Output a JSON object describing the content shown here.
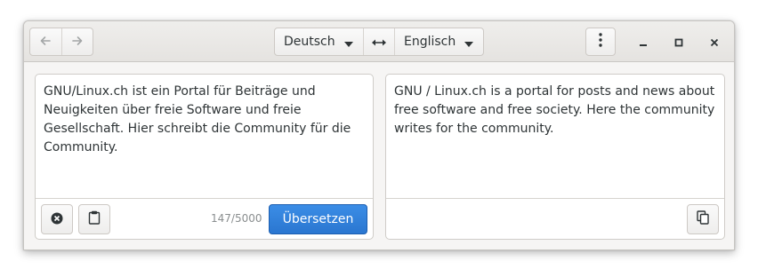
{
  "header": {
    "back_icon": "arrow-left-icon",
    "forward_icon": "arrow-right-icon",
    "source_language": "Deutsch",
    "target_language": "Englisch",
    "swap_icon": "swap-arrows-icon",
    "menu_icon": "vertical-dots-icon",
    "window_controls": [
      "minimize-icon",
      "maximize-icon",
      "close-icon"
    ]
  },
  "source": {
    "text": "GNU/Linux.ch ist ein Portal für Beiträge und Neuigkeiten über freie Software und freie Gesellschaft. Hier schreibt die Community für die Community.",
    "char_count": "147/5000",
    "clear_icon": "clear-circle-icon",
    "paste_icon": "clipboard-paste-icon",
    "translate_label": "Übersetzen"
  },
  "target": {
    "text": "GNU / Linux.ch is a portal for posts and news about free software and free society. Here the community writes for the community.",
    "copy_icon": "copy-icon"
  },
  "colors": {
    "accent": "#3584e4",
    "window_bg": "#f6f5f4",
    "text": "#2e3436"
  }
}
